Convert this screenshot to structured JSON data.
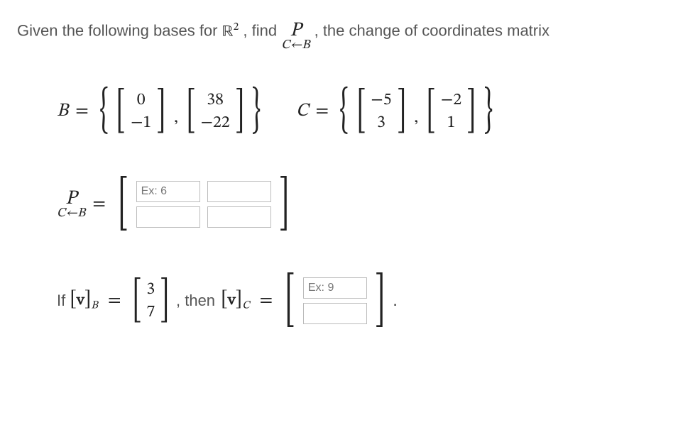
{
  "prompt": {
    "prefix": "Given the following bases for ",
    "space": "ℝ",
    "exp": "2",
    "mid": ", find ",
    "suffix": ", the change of coordinates matrix"
  },
  "P_symbol_top": "P",
  "sub_CB": "C←B",
  "B": {
    "name": "B",
    "v1": [
      "0",
      "−1"
    ],
    "v2": [
      "38",
      "−22"
    ]
  },
  "C": {
    "name": "C",
    "v1": [
      "−5",
      "3"
    ],
    "v2": [
      "−2",
      "1"
    ]
  },
  "matrix_input": {
    "placeholder_r1c1": "Ex: 6"
  },
  "result": {
    "prefix": "If ",
    "vB_label": "v",
    "vB_vec": [
      "3",
      "7"
    ],
    "mid": ", then ",
    "vC_label": "v",
    "placeholder_r1": "Ex: 9"
  },
  "symbols": {
    "eq": "=",
    "comma": ",",
    "lbrace": "{",
    "rbrace": "}",
    "lbrack": "[",
    "rbrack": "]",
    "period": "."
  }
}
